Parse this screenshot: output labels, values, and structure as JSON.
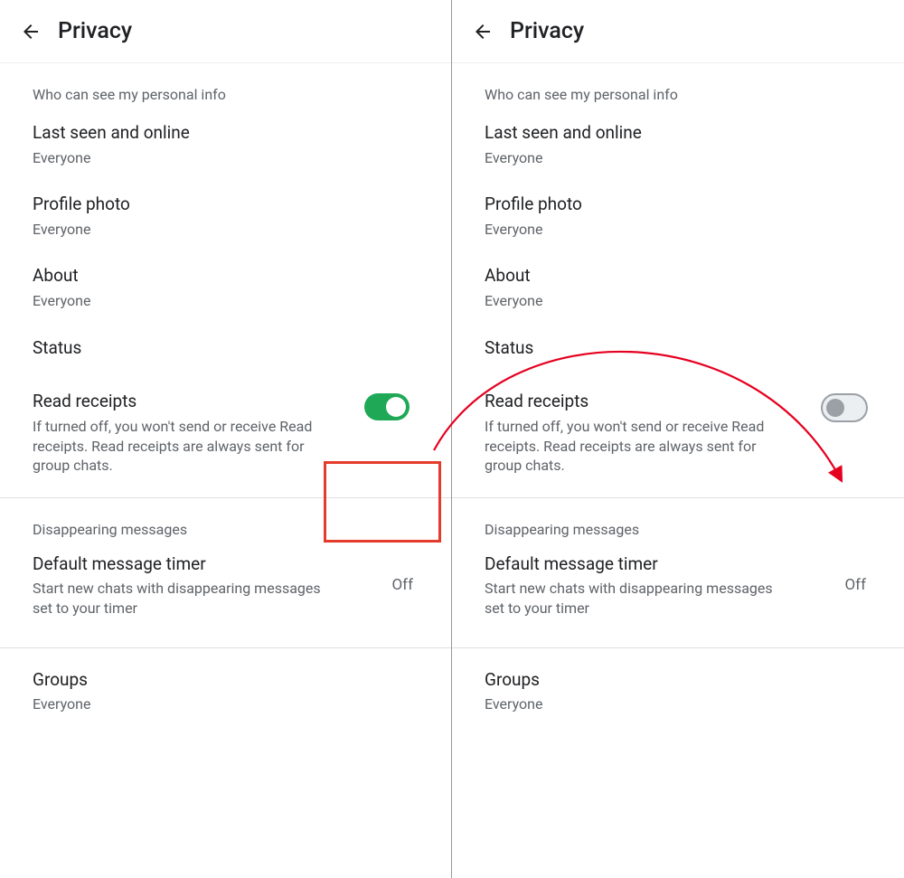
{
  "left": {
    "title": "Privacy",
    "section1_label": "Who can see my personal info",
    "last_seen": {
      "title": "Last seen and online",
      "value": "Everyone"
    },
    "profile_photo": {
      "title": "Profile photo",
      "value": "Everyone"
    },
    "about": {
      "title": "About",
      "value": "Everyone"
    },
    "status": {
      "title": "Status"
    },
    "read_receipts": {
      "title": "Read receipts",
      "desc": "If turned off, you won't send or receive Read receipts. Read receipts are always sent for group chats.",
      "toggle_on": true
    },
    "section2_label": "Disappearing messages",
    "default_timer": {
      "title": "Default message timer",
      "desc": "Start new chats with disappearing messages set to your timer",
      "value": "Off"
    },
    "groups": {
      "title": "Groups",
      "value": "Everyone"
    }
  },
  "right": {
    "title": "Privacy",
    "section1_label": "Who can see my personal info",
    "last_seen": {
      "title": "Last seen and online",
      "value": "Everyone"
    },
    "profile_photo": {
      "title": "Profile photo",
      "value": "Everyone"
    },
    "about": {
      "title": "About",
      "value": "Everyone"
    },
    "status": {
      "title": "Status"
    },
    "read_receipts": {
      "title": "Read receipts",
      "desc": "If turned off, you won't send or receive Read receipts. Read receipts are always sent for group chats.",
      "toggle_on": false
    },
    "section2_label": "Disappearing messages",
    "default_timer": {
      "title": "Default message timer",
      "desc": "Start new chats with disappearing messages set to your timer",
      "value": "Off"
    },
    "groups": {
      "title": "Groups",
      "value": "Everyone"
    }
  },
  "annotation": {
    "highlight_color": "#e43b2a",
    "arrow_color": "#e6001f"
  }
}
